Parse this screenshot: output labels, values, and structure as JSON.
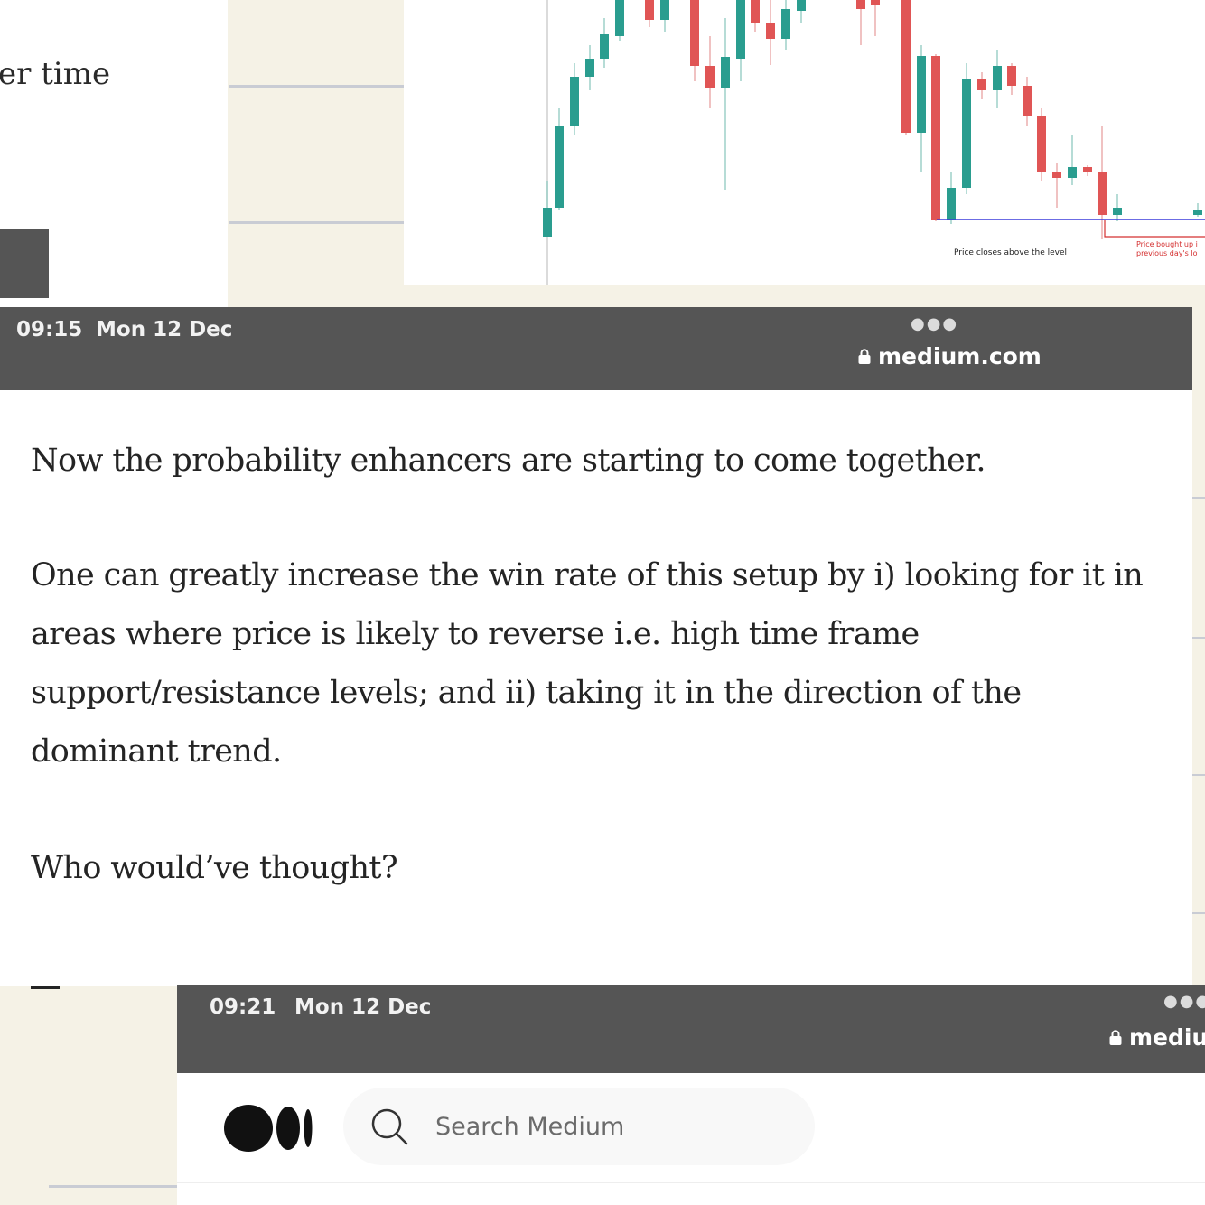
{
  "background_fragment": {
    "partial_text": "er time"
  },
  "chart_data": {
    "type": "candlestick",
    "annotations": [
      "Price closes above the level",
      "Price bought up i",
      "previous day's lo"
    ],
    "colors": {
      "up": "#2a9d8f",
      "down": "#e05555",
      "level_line": "#3b3bdb",
      "annotation_red": "#d43030"
    }
  },
  "screenshot_1": {
    "time": "09:15",
    "date": "Mon 12 Dec",
    "url": "medium.com"
  },
  "article": {
    "paragraphs": [
      "Now the probability enhancers are starting to come together.",
      "One can greatly increase the win rate of this setup by i) looking for it in areas where price is likely to reverse i.e. high time frame support/resistance levels; and ii) taking it in the direction of the dominant trend.",
      "Who would’ve thought?"
    ]
  },
  "screenshot_2": {
    "time": "09:21",
    "date": "Mon 12 Dec",
    "url": "mediu",
    "search_placeholder": "Search Medium"
  },
  "icons": {
    "lock": "lock-icon",
    "more": "more-dots-icon",
    "logo": "medium-logo-icon",
    "search": "search-icon"
  }
}
